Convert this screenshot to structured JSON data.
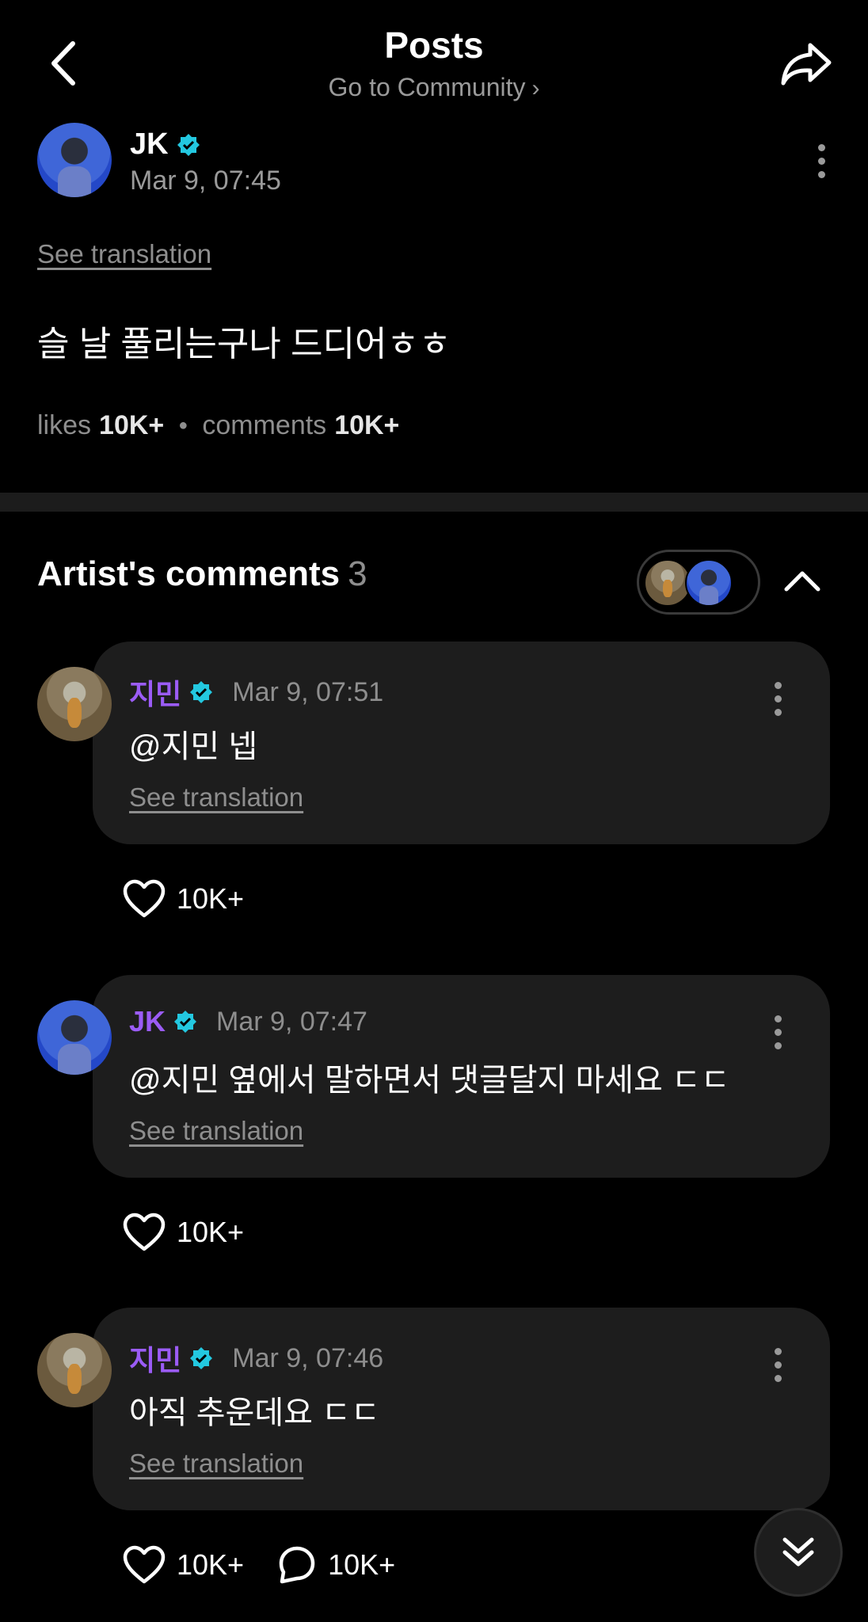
{
  "header": {
    "title": "Posts",
    "subtitle": "Go to Community",
    "subtitle_chevron": "›"
  },
  "post": {
    "author": "JK",
    "time": "Mar 9, 07:45",
    "see_translation": "See translation",
    "body": "슬 날 풀리는구나 드디어ㅎㅎ",
    "likes_label": "likes",
    "likes_value": "10K+",
    "comments_label": "comments",
    "comments_value": "10K+"
  },
  "artist_comments": {
    "title": "Artist's comments",
    "count": "3"
  },
  "comments": [
    {
      "author": "지민",
      "time": "Mar 9, 07:51",
      "text": "@지민 넵",
      "see_translation": "See translation",
      "likes": "10K+"
    },
    {
      "author": "JK",
      "time": "Mar 9, 07:47",
      "text": "@지민 옆에서 말하면서 댓글달지 마세요 ㄷㄷ",
      "see_translation": "See translation",
      "likes": "10K+"
    },
    {
      "author": "지민",
      "time": "Mar 9, 07:46",
      "text": "아직 추운데요 ㄷㄷ",
      "see_translation": "See translation",
      "likes": "10K+",
      "replies": "10K+"
    }
  ],
  "colors": {
    "background": "#000000",
    "bubble": "#1d1d1d",
    "artist_name": "#9b5cf6",
    "verified": "#23c8e0",
    "muted": "#8e8e8e"
  },
  "icons": [
    "back-arrow-icon",
    "share-icon",
    "verified-icon",
    "more-vertical-icon",
    "chevron-up-icon",
    "heart-icon",
    "comment-bubble-icon",
    "double-chevron-down-icon"
  ]
}
